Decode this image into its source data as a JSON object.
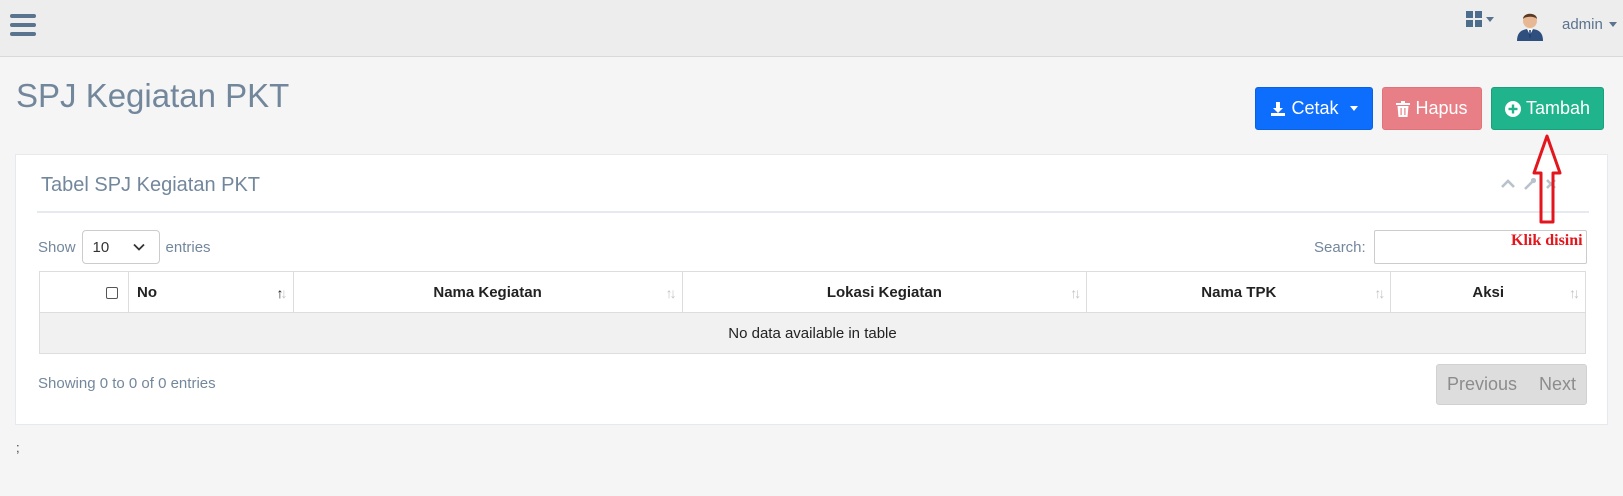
{
  "topbar": {
    "menu_icon": "hamburger-menu-icon",
    "apps_icon": "grid-apps-icon",
    "user_name": "admin"
  },
  "page": {
    "title": "SPJ Kegiatan PKT"
  },
  "actions": {
    "cetak_label": "Cetak",
    "hapus_label": "Hapus",
    "tambah_label": "Tambah",
    "colors": {
      "cetak": "#0d6efd",
      "hapus": "#e97f86",
      "tambah": "#1fb48b"
    }
  },
  "panel": {
    "title": "Tabel SPJ Kegiatan PKT",
    "tools": [
      "chevron-up-icon",
      "wrench-icon",
      "close-icon"
    ]
  },
  "datatable": {
    "show_label": "Show",
    "entries_label": "entries",
    "page_size": "10",
    "search_label": "Search:",
    "search_value": "",
    "columns": [
      "No",
      "Nama Kegiatan",
      "Lokasi Kegiatan",
      "Nama TPK",
      "Aksi"
    ],
    "empty_message": "No data available in table",
    "info": "Showing 0 to 0 of 0 entries",
    "previous_label": "Previous",
    "next_label": "Next"
  },
  "annotation": {
    "text": "Klik disini",
    "color": "#e3161d"
  },
  "footer": {
    "text": ";"
  }
}
